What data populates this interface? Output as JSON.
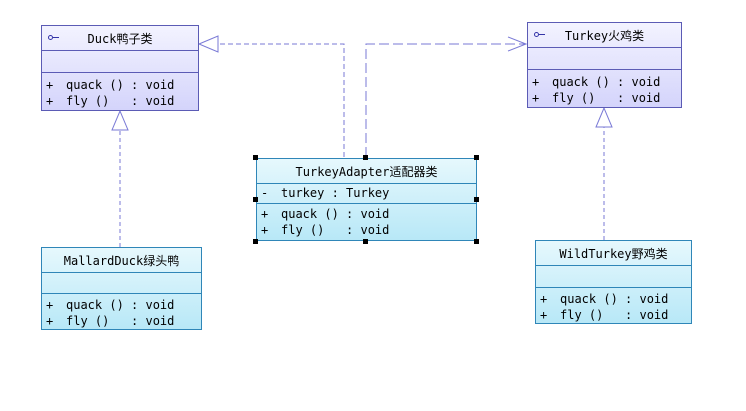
{
  "classes": {
    "duck": {
      "name": "Duck鸭子类",
      "attributes": [],
      "operations": [
        {
          "vis": "+",
          "text": "quack () : void"
        },
        {
          "vis": "+",
          "text": "fly ()   : void"
        }
      ]
    },
    "turkey": {
      "name": "Turkey火鸡类",
      "attributes": [],
      "operations": [
        {
          "vis": "+",
          "text": "quack () : void"
        },
        {
          "vis": "+",
          "text": "fly ()   : void"
        }
      ]
    },
    "adapter": {
      "name": "TurkeyAdapter适配器类",
      "attributes": [
        {
          "vis": "-",
          "text": "turkey : Turkey"
        }
      ],
      "operations": [
        {
          "vis": "+",
          "text": "quack () : void"
        },
        {
          "vis": "+",
          "text": "fly ()   : void"
        }
      ]
    },
    "mallard": {
      "name": "MallardDuck绿头鸭",
      "attributes": [],
      "operations": [
        {
          "vis": "+",
          "text": "quack () : void"
        },
        {
          "vis": "+",
          "text": "fly ()   : void"
        }
      ]
    },
    "wildturkey": {
      "name": "WildTurkey野鸡类",
      "attributes": [],
      "operations": [
        {
          "vis": "+",
          "text": "quack () : void"
        },
        {
          "vis": "+",
          "text": "fly ()   : void"
        }
      ]
    }
  },
  "colors": {
    "interface_border": "#5b5bb5",
    "interface_fill": "#d4d4fb",
    "class_border": "#2f86b8",
    "class_fill": "#b8e8f7",
    "connector": "#7a7ad6"
  }
}
